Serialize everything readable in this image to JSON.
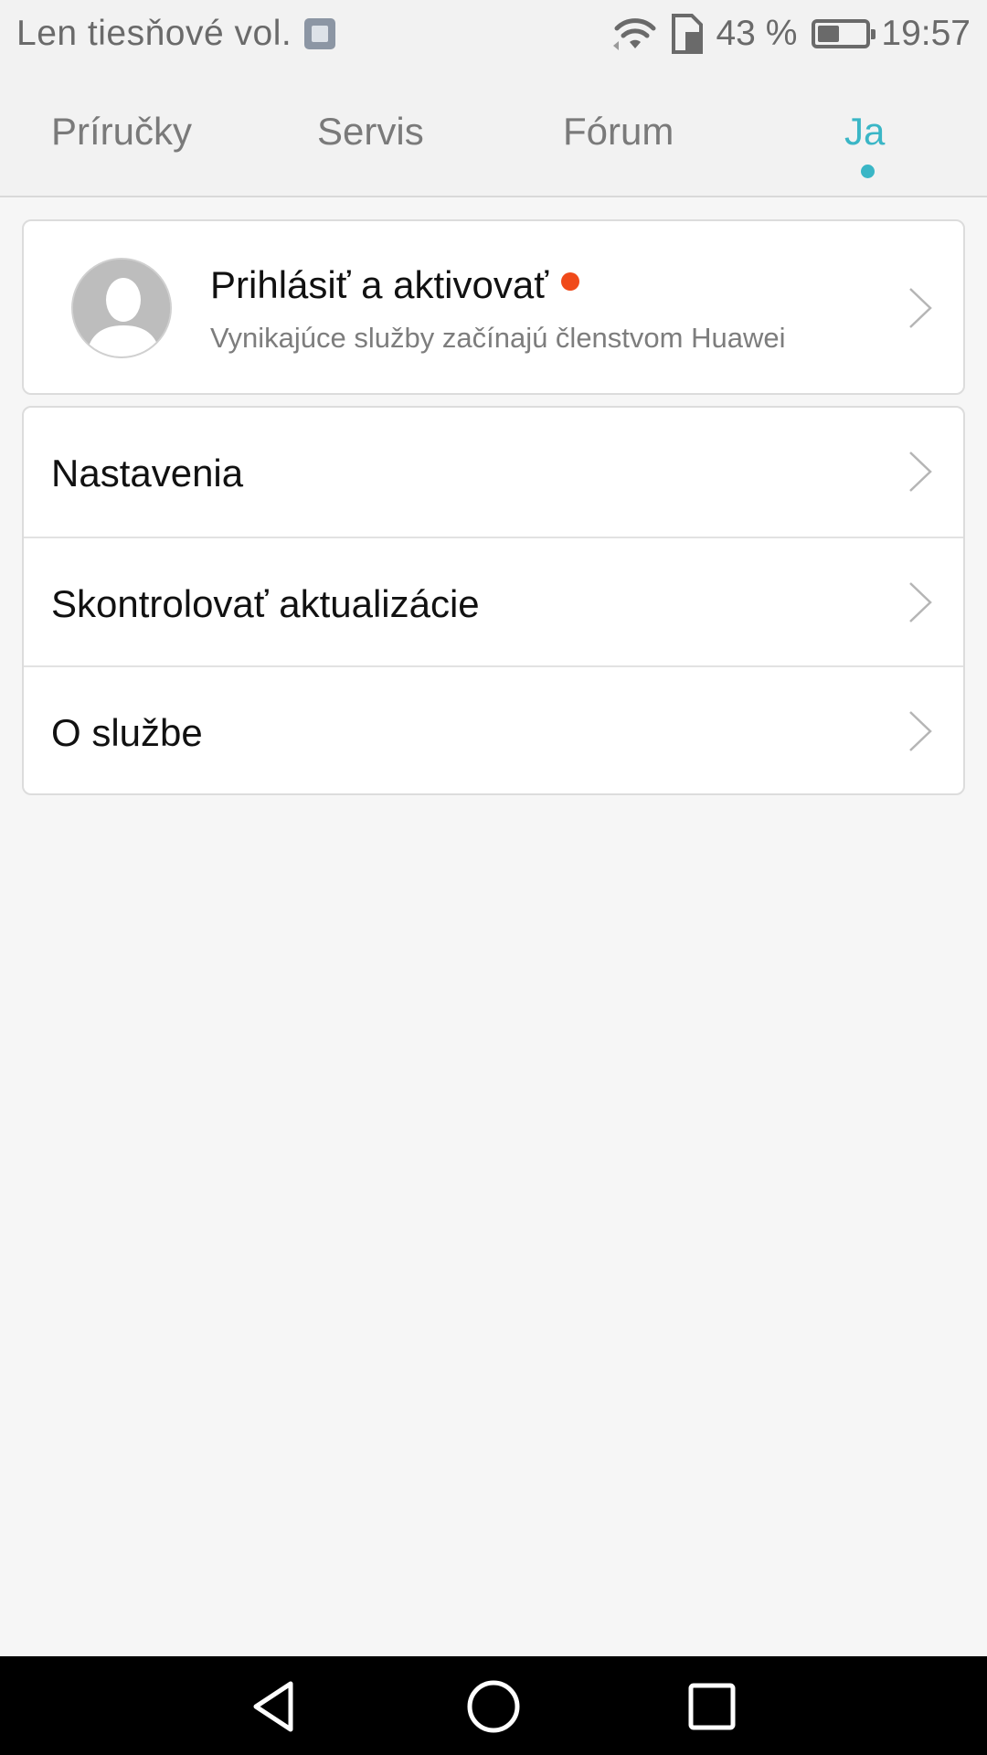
{
  "status_bar": {
    "carrier": "Len tiesňové vol.",
    "battery_text": "43 %",
    "battery_level": 0.43,
    "time": "19:57",
    "icons": [
      "image-notification-icon",
      "wifi-icon",
      "sim-icon",
      "battery-icon"
    ]
  },
  "tabs": [
    {
      "label": "Príručky",
      "active": false
    },
    {
      "label": "Servis",
      "active": false
    },
    {
      "label": "Fórum",
      "active": false
    },
    {
      "label": "Ja",
      "active": true
    }
  ],
  "account": {
    "title": "Prihlásiť a aktivovať",
    "subtitle": "Vynikajúce služby začínajú členstvom Huawei"
  },
  "menu": [
    {
      "label": "Nastavenia"
    },
    {
      "label": "Skontrolovať aktualizácie"
    },
    {
      "label": "O službe"
    }
  ],
  "colors": {
    "accent": "#3ab6c6",
    "badge": "#f04a1a",
    "background": "#f6f6f6"
  },
  "nav_bar": [
    "back-icon",
    "home-icon",
    "recents-icon"
  ]
}
